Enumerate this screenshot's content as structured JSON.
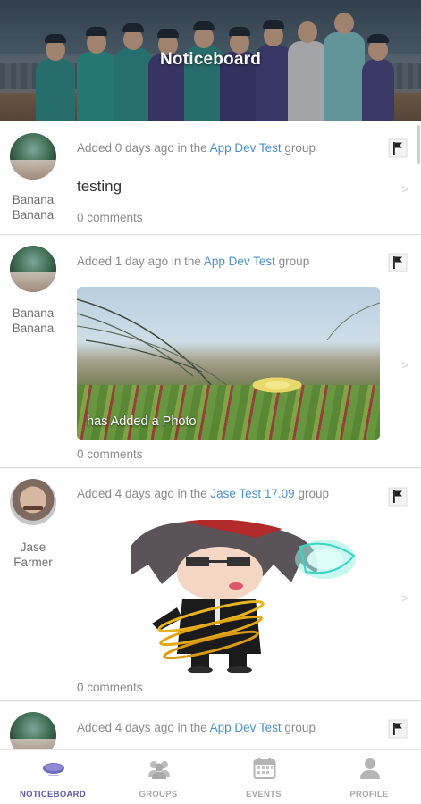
{
  "header": {
    "title": "Noticeboard"
  },
  "posts": [
    {
      "author": "Banana Banana",
      "author_lines": [
        "Banana",
        "Banana"
      ],
      "meta_prefix": "Added 0 days ago in the ",
      "group": "App Dev Test",
      "meta_suffix": " group",
      "text": "testing",
      "comments": "0 comments",
      "avatar_icon": "avatar-green-icon"
    },
    {
      "author": "Banana Banana",
      "author_lines": [
        "Banana",
        "Banana"
      ],
      "meta_prefix": "Added 1 day ago in the ",
      "group": "App Dev Test",
      "meta_suffix": " group",
      "photo_caption": "has Added a Photo",
      "comments": "0 comments",
      "avatar_icon": "avatar-green-icon"
    },
    {
      "author": "Jase Farmer",
      "author_lines": [
        "Jase",
        "Farmer"
      ],
      "meta_prefix": "Added 4 days ago in the ",
      "group": "Jase Test 17.09",
      "meta_suffix": " group",
      "photo_caption": "",
      "comments": "0 comments",
      "avatar_icon": "avatar-face-icon"
    },
    {
      "meta_prefix": "Added 4 days ago in the ",
      "group": "App Dev Test",
      "meta_suffix": " group",
      "avatar_icon": "avatar-green-icon"
    }
  ],
  "nav": {
    "items": [
      {
        "label": "NOTICEBOARD",
        "icon": "noticeboard-icon",
        "active": true
      },
      {
        "label": "GROUPS",
        "icon": "groups-icon",
        "active": false
      },
      {
        "label": "EVENTS",
        "icon": "calendar-icon",
        "active": false
      },
      {
        "label": "PROFILE",
        "icon": "profile-icon",
        "active": false
      }
    ]
  },
  "colors": {
    "accent": "#5e5aa8",
    "link": "#4a8fcf",
    "muted": "#8a8a8a"
  }
}
